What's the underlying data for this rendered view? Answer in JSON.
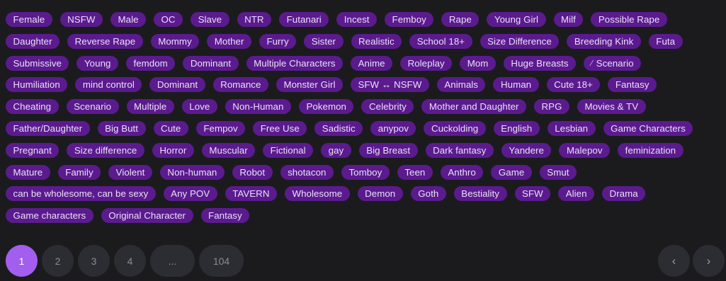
{
  "tags": [
    [
      "Female",
      "NSFW",
      "Male",
      "OC",
      "Slave",
      "NTR",
      "Futanari",
      "Incest",
      "Femboy",
      "Rape",
      "Young Girl",
      "Milf",
      "Possible Rape"
    ],
    [
      "Daughter",
      "Reverse Rape",
      "Mommy",
      "Mother",
      "Furry",
      "Sister",
      "Realistic",
      "School 18+",
      "Size Difference",
      "Breeding Kink",
      "Futa"
    ],
    [
      "Submissive",
      "Young",
      "femdom",
      "Dominant",
      "Multiple Characters",
      "Anime",
      "Roleplay",
      "Mom",
      "Huge Breasts",
      "Scenario"
    ],
    [
      "Humiliation",
      "mind control",
      "Dominant",
      "Romance",
      "Monster Girl",
      "SFW ↔ NSFW",
      "Animals",
      "Human",
      "Cute 18+",
      "Fantasy"
    ],
    [
      "Cheating",
      "Scenario",
      "Multiple",
      "Love",
      "Non-Human",
      "Pokemon",
      "Celebrity",
      "Mother and Daughter",
      "RPG",
      "Movies & TV"
    ],
    [
      "Father/Daughter",
      "Big Butt",
      "Cute",
      "Fempov",
      "Free Use",
      "Sadistic",
      "anypov",
      "Cuckolding",
      "English",
      "Lesbian",
      "Game Characters"
    ],
    [
      "Pregnant",
      "Size difference",
      "Horror",
      "Muscular",
      "Fictional",
      "gay",
      "Big Breast",
      "Dark fantasy",
      "Yandere",
      "Malepov",
      "feminization"
    ],
    [
      "Mature",
      "Family",
      "Violent",
      "Non-human",
      "Robot",
      "shotacon",
      "Tomboy",
      "Teen",
      "Anthro",
      "Game",
      "Smut"
    ],
    [
      "can be wholesome, can be sexy",
      "Any POV",
      "TAVERN",
      "Wholesome",
      "Demon",
      "Goth",
      "Bestiality",
      "SFW",
      "Alien",
      "Drama"
    ],
    [
      "Game characters",
      "Original Character",
      "Fantasy"
    ]
  ],
  "scenario_emoji_icon": "syringe-icon",
  "pagination": {
    "pages": [
      "1",
      "2",
      "3",
      "4",
      "...",
      "104"
    ],
    "current": "1",
    "prev_icon": "chevron-left-icon",
    "next_icon": "chevron-right-icon",
    "prev_label": "‹",
    "next_label": "›"
  },
  "colors": {
    "background": "#1b1b1e",
    "tag_bg": "#5b1b8e",
    "tag_text": "#eae0f6",
    "page_active": "#a35ef0",
    "page_inactive": "#2c2d32"
  }
}
